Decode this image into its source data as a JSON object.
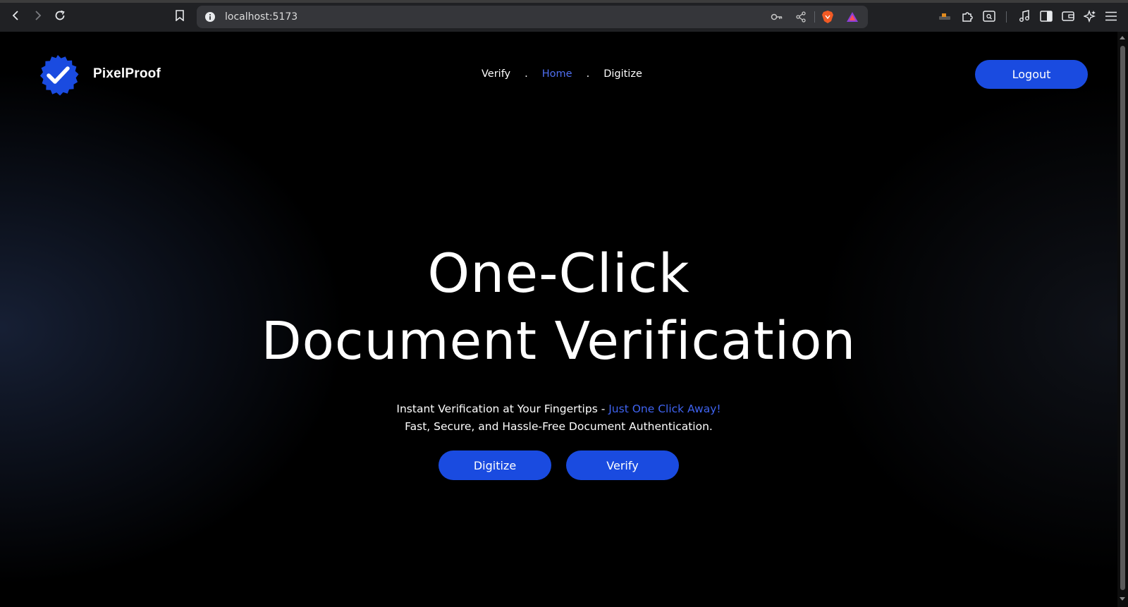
{
  "browser": {
    "url": "localhost:5173"
  },
  "nav": {
    "brand": "PixelProof",
    "links": [
      {
        "label": "Verify",
        "active": false
      },
      {
        "label": "Home",
        "active": true
      },
      {
        "label": "Digitize",
        "active": false
      }
    ],
    "separator": ".",
    "logout_label": "Logout"
  },
  "hero": {
    "title_line1": "One-Click",
    "title_line2": "Document Verification",
    "subtitle_line1_prefix": "Instant Verification at Your Fingertips - ",
    "subtitle_line1_accent": "Just One Click Away!",
    "subtitle_line2": "Fast, Secure, and Hassle-Free Document Authentication.",
    "buttons": {
      "digitize": "Digitize",
      "verify": "Verify"
    }
  },
  "colors": {
    "accent": "#1a4be0",
    "link_active": "#4f6ff2",
    "background": "#000000"
  }
}
